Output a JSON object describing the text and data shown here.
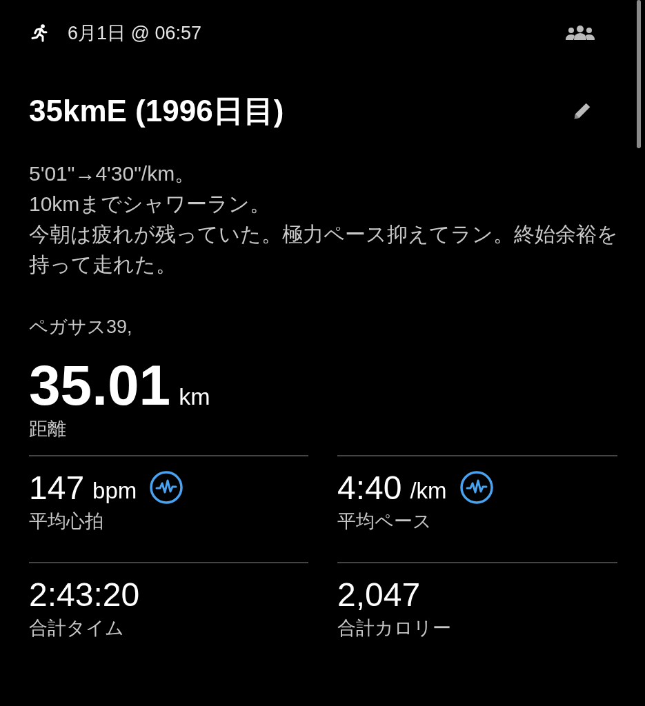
{
  "header": {
    "datetime": "6月1日 @ 06:57"
  },
  "title": "35kmE (1996日目)",
  "description": [
    "5'01\"→4'30\"/km。",
    "10kmまでシャワーラン。",
    "今朝は疲れが残っていた。極力ペース抑えてラン。終始余裕を持って走れた。"
  ],
  "gear": "ペガサス39,",
  "distance": {
    "value": "35.01",
    "unit": "km",
    "label": "距離"
  },
  "stats": [
    {
      "value": "147",
      "unit": "bpm",
      "label": "平均心拍",
      "chart_icon": true
    },
    {
      "value": "4:40",
      "unit": "/km",
      "label": "平均ペース",
      "chart_icon": true
    },
    {
      "value": "2:43:20",
      "label": "合計タイム",
      "chart_icon": false
    },
    {
      "value": "2,047",
      "label": "合計カロリー",
      "chart_icon": false
    }
  ]
}
